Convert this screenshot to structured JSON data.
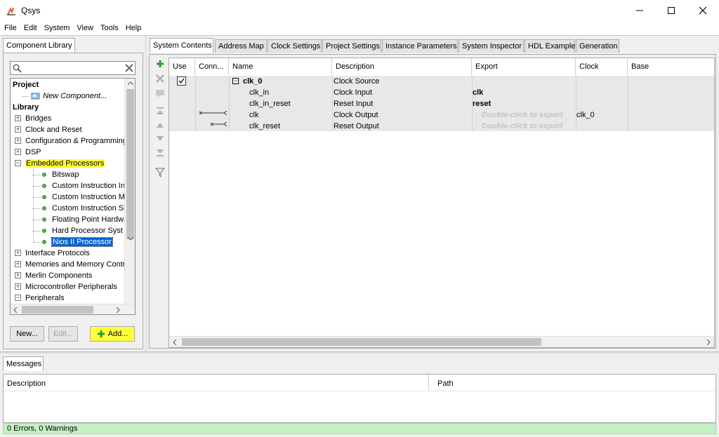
{
  "window": {
    "title": "Qsys"
  },
  "menu": [
    "File",
    "Edit",
    "System",
    "View",
    "Tools",
    "Help"
  ],
  "left_panel": {
    "tab_label": "Component Library",
    "search": {
      "value": "",
      "placeholder": ""
    },
    "tree": {
      "project_heading": "Project",
      "new_component": "New Component...",
      "library_heading": "Library",
      "groups": [
        {
          "label": "Bridges",
          "state": "collapsed"
        },
        {
          "label": "Clock and Reset",
          "state": "collapsed"
        },
        {
          "label": "Configuration & Programming",
          "state": "collapsed"
        },
        {
          "label": "DSP",
          "state": "collapsed"
        },
        {
          "label": "Embedded Processors",
          "state": "expanded",
          "highlighted": true,
          "children": [
            "Bitswap",
            "Custom Instruction Int",
            "Custom Instruction Ma",
            "Custom Instruction Sl",
            "Floating Point Hardwa",
            "Hard Processor Syst",
            "Nios II Processor"
          ],
          "selected_child": "Nios II Processor"
        },
        {
          "label": "Interface Protocols",
          "state": "collapsed"
        },
        {
          "label": "Memories and Memory Contro",
          "state": "collapsed"
        },
        {
          "label": "Merlin Components",
          "state": "collapsed"
        },
        {
          "label": "Microcontroller Peripherals",
          "state": "collapsed"
        },
        {
          "label": "Peripherals",
          "state": "expanded"
        }
      ]
    },
    "buttons": {
      "new": "New...",
      "edit": "Edit...",
      "add": "Add..."
    }
  },
  "tabs": [
    "System Contents",
    "Address Map",
    "Clock Settings",
    "Project Settings",
    "Instance Parameters",
    "System Inspector",
    "HDL Example",
    "Generation"
  ],
  "active_tab": "System Contents",
  "table": {
    "columns": [
      "Use",
      "Conn...",
      "Name",
      "Description",
      "Export",
      "Clock",
      "Base"
    ],
    "rows": [
      {
        "use_checked": true,
        "name": "clk_0",
        "description": "Clock Source",
        "export": "",
        "clock": "",
        "level": 0
      },
      {
        "name": "clk_in",
        "description": "Clock Input",
        "export": "clk",
        "clock": "",
        "level": 1
      },
      {
        "name": "clk_in_reset",
        "description": "Reset Input",
        "export": "reset",
        "clock": "",
        "level": 1
      },
      {
        "name": "clk",
        "description": "Clock Output",
        "export": "Double-click to export",
        "clock": "clk_0",
        "level": 1
      },
      {
        "name": "clk_reset",
        "description": "Reset Output",
        "export": "Double-click to export",
        "clock": "",
        "level": 1
      }
    ]
  },
  "messages": {
    "tab_label": "Messages",
    "columns": [
      "Description",
      "Path"
    ],
    "status": "0 Errors, 0 Warnings"
  },
  "colors": {
    "highlight": "#ffff3c",
    "selection": "#0a64d2",
    "status_bg": "#c5f2c4"
  },
  "icons": [
    "qsys-app-icon",
    "minimize-icon",
    "maximize-icon",
    "close-icon",
    "search-icon",
    "clear-icon",
    "new-component-icon",
    "plus-icon",
    "remove-icon",
    "edit-icon",
    "move-top-icon",
    "move-up-icon",
    "move-down-icon",
    "move-bottom-icon",
    "filter-icon"
  ]
}
